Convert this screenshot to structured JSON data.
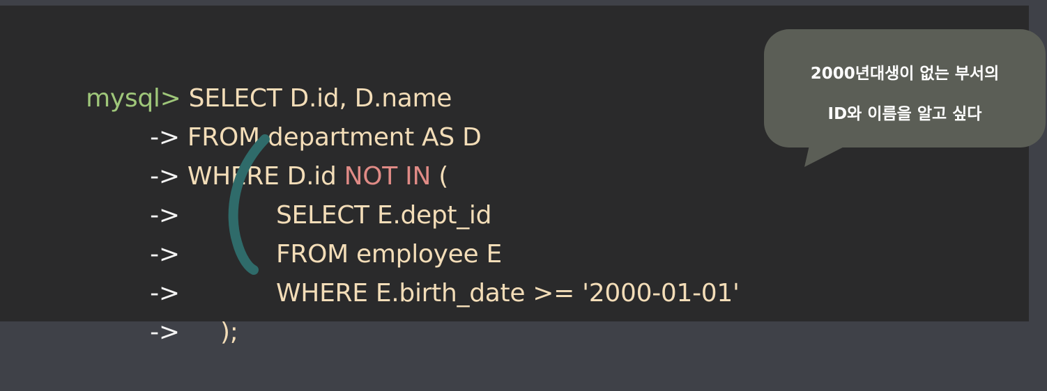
{
  "terminal": {
    "prompt": "mysql>",
    "lines": [
      {
        "prefix": "",
        "text": " SELECT D.id, D.name"
      },
      {
        "prefix": "->",
        "text": " FROM department AS D"
      },
      {
        "prefix": "->",
        "text_a": " WHERE D.id ",
        "text_kw": "NOT IN",
        "text_b": " ("
      },
      {
        "prefix": "->",
        "text": "SELECT E.dept_id"
      },
      {
        "prefix": "->",
        "text": "FROM employee E"
      },
      {
        "prefix": "->",
        "text": "WHERE E.birth_date >= '2000-01-01'"
      },
      {
        "prefix": "->",
        "text": ");"
      }
    ]
  },
  "bubble": {
    "line1": "2000년대생이 없는 부서의",
    "line2": "ID와 이름을 알고 싶다"
  },
  "colors": {
    "prompt": "#9fc77a",
    "code": "#f3ddb8",
    "keyword_highlight": "#e08b86",
    "annotation": "#2f6b6a",
    "bubble": "#5b5e56"
  }
}
